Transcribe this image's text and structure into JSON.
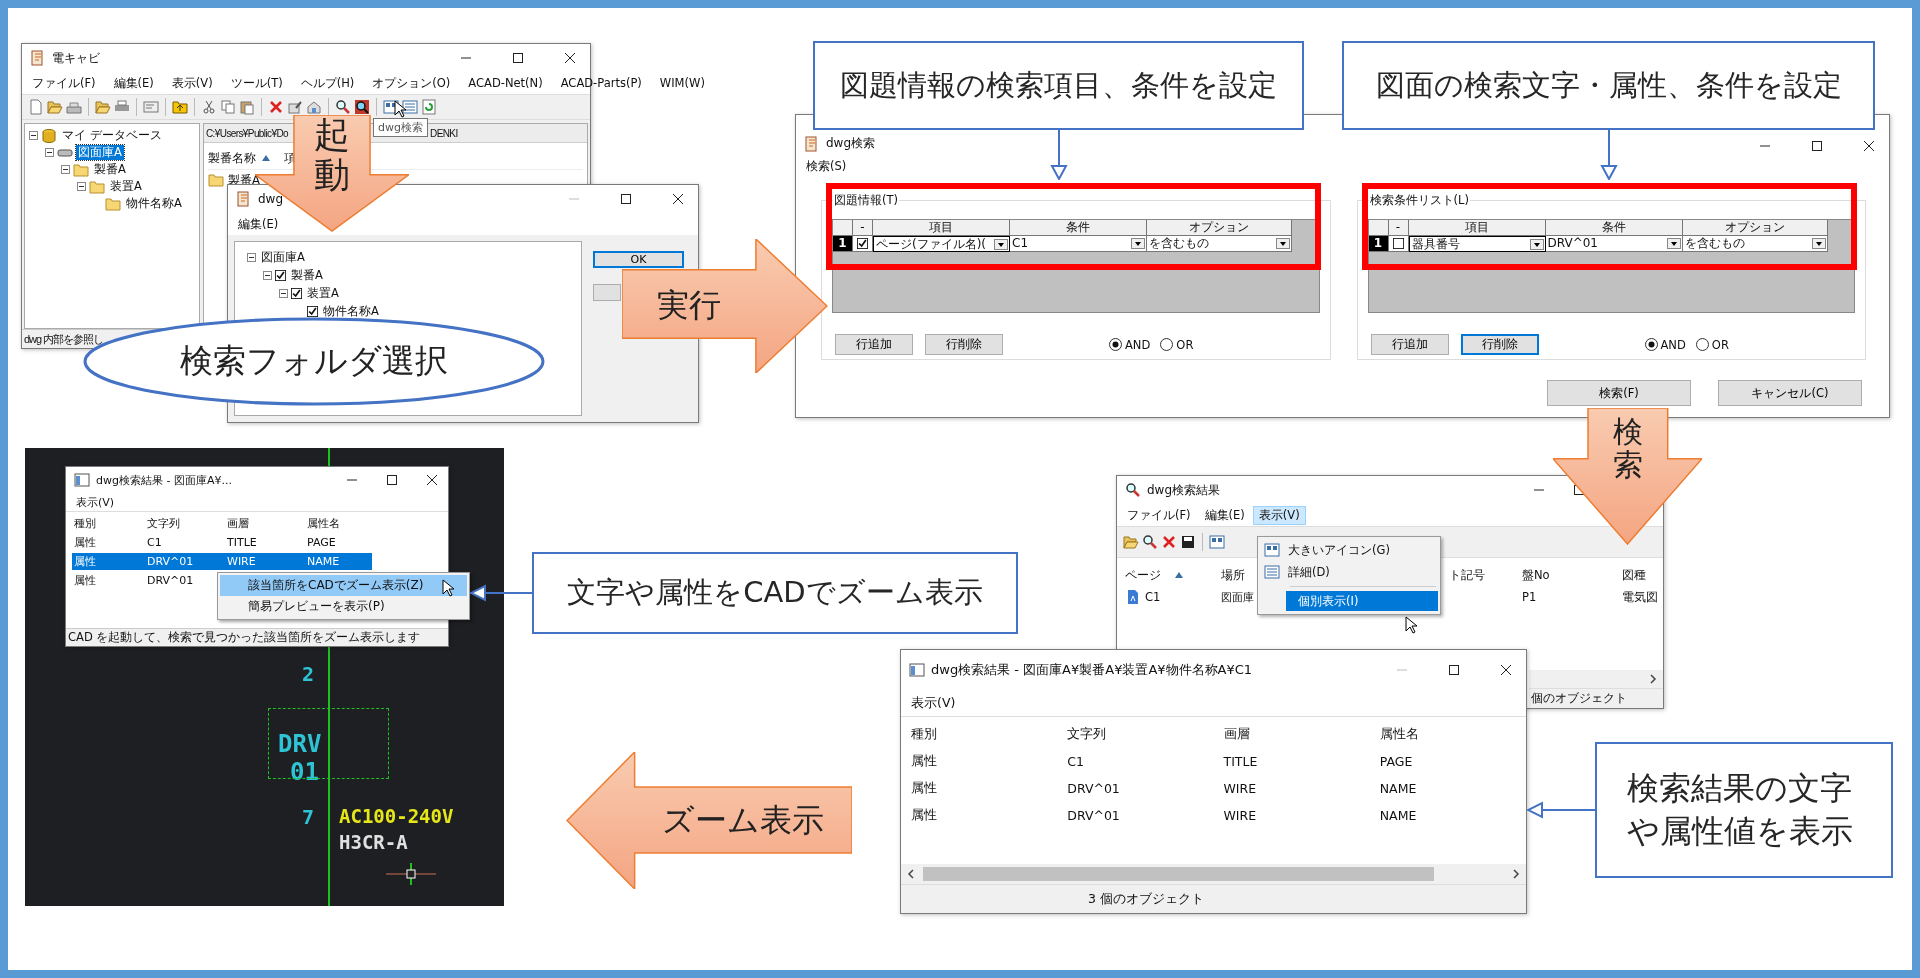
{
  "main_window": {
    "title": "電キャビ",
    "menu": [
      "ファイル(F)",
      "編集(E)",
      "表示(V)",
      "ツール(T)",
      "ヘルプ(H)",
      "オプション(O)",
      "ACAD-Net(N)",
      "ACAD-Parts(P)",
      "WIM(W)"
    ],
    "tooltip": "dwg検索",
    "tree": [
      {
        "label": "マイ データベース",
        "selected": false,
        "children": [
          {
            "label": "図面庫A",
            "selected": true,
            "children": [
              {
                "label": "製番A",
                "selected": false,
                "children": [
                  {
                    "label": "装置A",
                    "selected": false,
                    "children": [
                      {
                        "label": "物件名称A",
                        "selected": false
                      }
                    ]
                  }
                ]
              }
            ]
          }
        ]
      }
    ],
    "path_bar": [
      "C:¥Users¥Public¥Do",
      "DENKI"
    ],
    "list": {
      "columns": [
        "製番名称",
        "項"
      ],
      "rows": [
        "製番A"
      ]
    },
    "status_bar": "dwg 内部を参照し"
  },
  "folder_dialog": {
    "title": "dwg",
    "menu": [
      "編集(E)"
    ],
    "tree": [
      {
        "label": "図面庫A",
        "children": [
          {
            "label": "製番A",
            "checked": true,
            "children": [
              {
                "label": "装置A",
                "checked": true,
                "children": [
                  {
                    "label": "物件名称A",
                    "checked": true
                  }
                ]
              }
            ]
          }
        ]
      }
    ],
    "buttons": [
      "OK"
    ]
  },
  "search_dialog": {
    "title": "dwg検索",
    "menu": [
      "検索(S)"
    ],
    "groups": [
      {
        "title": "図題情報(T)",
        "columns": [
          "-",
          "項目",
          "条件",
          "オプション"
        ],
        "rows": [
          {
            "number": "1",
            "checked": true,
            "item": "ページ(ファイル名)(",
            "condition": "C1",
            "option": "を含むもの"
          }
        ],
        "buttons": [
          {
            "label": "行追加",
            "focused": false
          },
          {
            "label": "行削除",
            "focused": false
          }
        ],
        "logic": [
          {
            "label": "AND",
            "selected": true
          },
          {
            "label": "OR",
            "selected": false
          }
        ]
      },
      {
        "title": "検索条件リスト(L)",
        "columns": [
          "-",
          "項目",
          "条件",
          "オプション"
        ],
        "rows": [
          {
            "number": "1",
            "checked": false,
            "item": "器具番号",
            "condition": "DRV^01",
            "option": "を含むもの"
          }
        ],
        "buttons": [
          {
            "label": "行追加",
            "focused": false
          },
          {
            "label": "行削除",
            "focused": true
          }
        ],
        "logic": [
          {
            "label": "AND",
            "selected": true
          },
          {
            "label": "OR",
            "selected": false
          }
        ]
      }
    ],
    "buttons": [
      "検索(F)",
      "キャンセル(C)"
    ]
  },
  "results_window": {
    "title": "dwg検索結果",
    "menu": [
      {
        "label": "ファイル(F)",
        "selected": false
      },
      {
        "label": "編集(E)",
        "selected": false
      },
      {
        "label": "表示(V)",
        "selected": true
      }
    ],
    "view_menu": [
      {
        "label": "大きいアイコン(G)",
        "selected": false
      },
      {
        "label": "詳細(D)",
        "selected": false
      },
      {
        "label": "個別表示(I)",
        "selected": true
      }
    ],
    "columns": [
      "ページ",
      "場所",
      "ト記号",
      "盤No",
      "図種"
    ],
    "rows": [
      {
        "page": "C1",
        "place": "図面庫",
        "panel_no": "P1",
        "drawing_type": "電気図"
      }
    ],
    "status_bar": "個のオブジェクト"
  },
  "detail_window": {
    "title": "dwg検索結果 - 図面庫A¥製番A¥装置A¥物件名称A¥C1",
    "menu": [
      "表示(V)"
    ],
    "columns": [
      "種別",
      "文字列",
      "画層",
      "属性名"
    ],
    "rows": [
      [
        "属性",
        "C1",
        "TITLE",
        "PAGE"
      ],
      [
        "属性",
        "DRV^01",
        "WIRE",
        "NAME"
      ],
      [
        "属性",
        "DRV^01",
        "WIRE",
        "NAME"
      ]
    ],
    "status_bar": "3 個のオブジェクト"
  },
  "cad_view": {
    "window": {
      "title": "dwg検索結果 - 図面庫A¥...",
      "menu": [
        "表示(V)"
      ],
      "columns": [
        "種別",
        "文字列",
        "画層",
        "属性名"
      ],
      "rows": [
        {
          "cells": [
            "属性",
            "C1",
            "TITLE",
            "PAGE"
          ],
          "selected": false
        },
        {
          "cells": [
            "属性",
            "DRV^01",
            "WIRE",
            "NAME"
          ],
          "selected": true
        },
        {
          "cells": [
            "属性",
            "DRV^01"
          ],
          "selected": false
        }
      ],
      "status_bar": "CAD を起動して、検索で見つかった該当箇所をズーム表示します"
    },
    "context_menu": [
      {
        "label": "該当箇所をCADでズーム表示(Z)",
        "selected": true
      },
      {
        "label": "簡易プレビューを表示(P)",
        "selected": false
      }
    ],
    "labels": [
      {
        "text": "2",
        "color": "#2ec4d6"
      },
      {
        "text": "DRV",
        "color": "#2ec4d6"
      },
      {
        "text": "01",
        "color": "#2ec4d6"
      },
      {
        "text": "7",
        "color": "#2ec4d6"
      },
      {
        "text": "AC100-240V",
        "color": "#e6e619"
      },
      {
        "text": "H3CR-A",
        "color": "#e0e0e0"
      }
    ]
  },
  "annotations": [
    {
      "kind": "downarrow",
      "text": "起動"
    },
    {
      "kind": "ellipse",
      "text": "検索フォルダ選択"
    },
    {
      "kind": "rightarrow",
      "text": "実行"
    },
    {
      "kind": "downcallout",
      "text": "図題情報の検索項目、条件を設定"
    },
    {
      "kind": "downcallout",
      "text": "図面の検索文字・属性、条件を設定"
    },
    {
      "kind": "downarrow",
      "text": "検索"
    },
    {
      "kind": "leftcallout",
      "text": "文字や属性をCADでズーム表示"
    },
    {
      "kind": "leftarrow",
      "text": "ズーム表示"
    },
    {
      "kind": "leftcallout",
      "text": "検索結果の文字や属性値を表示"
    }
  ]
}
